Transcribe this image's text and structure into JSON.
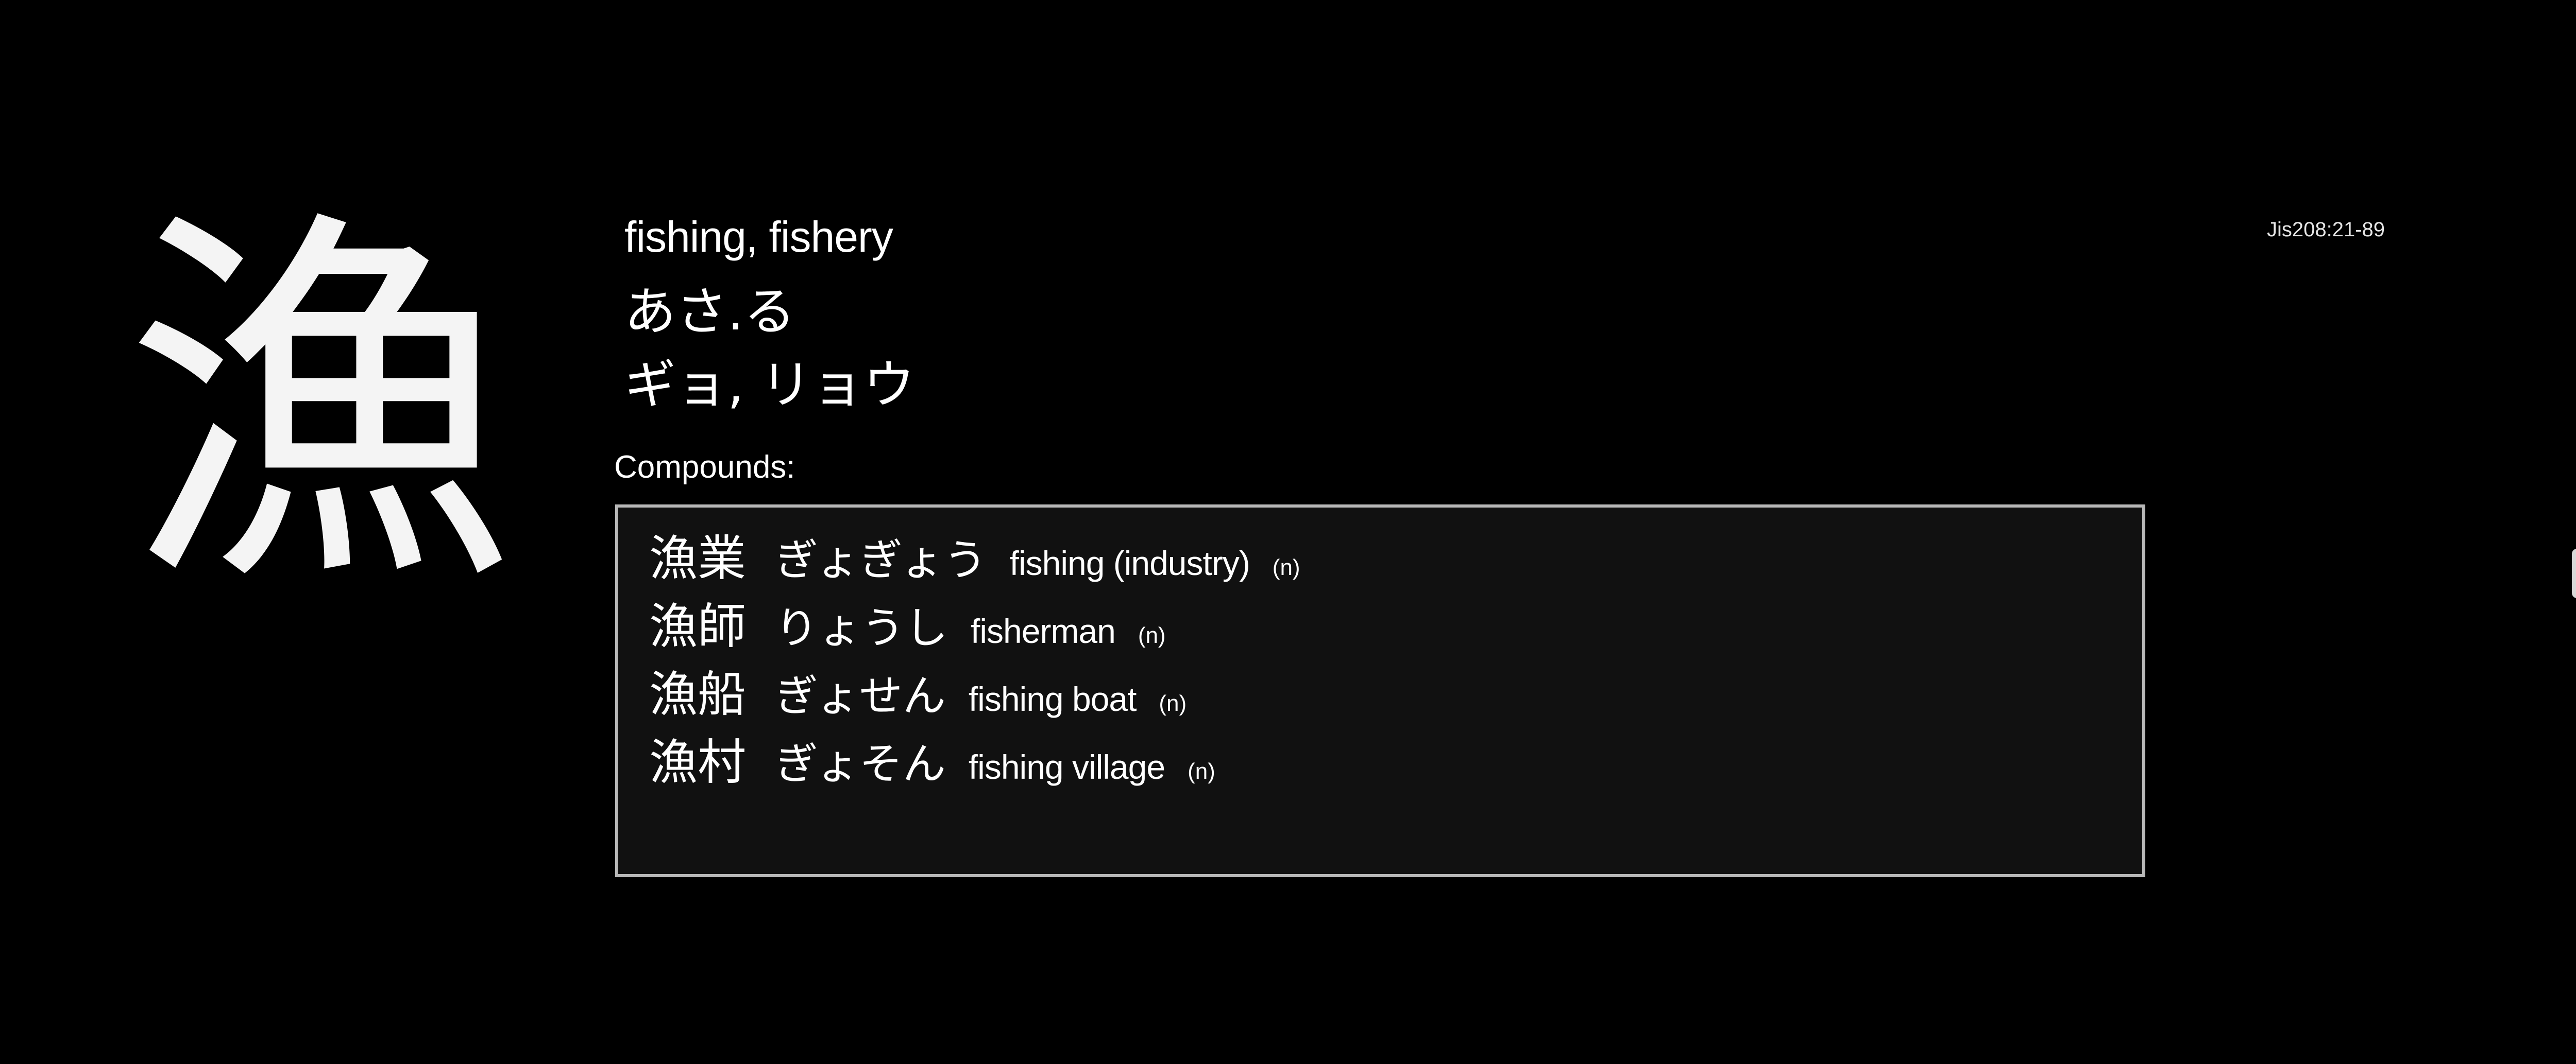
{
  "kanji": {
    "character": "漁",
    "meaning": "fishing, fishery",
    "kun_reading": "あさ.る",
    "on_reading": "ギョ, リョウ",
    "jis_code": "Jis208:21-89"
  },
  "compounds": {
    "label": "Compounds:",
    "items": [
      {
        "word": "漁業",
        "reading": "ぎょぎょう",
        "gloss": "fishing (industry)",
        "pos": "(n)"
      },
      {
        "word": "漁師",
        "reading": "りょうし",
        "gloss": "fisherman",
        "pos": "(n)"
      },
      {
        "word": "漁船",
        "reading": "ぎょせん",
        "gloss": "fishing boat",
        "pos": "(n)"
      },
      {
        "word": "漁村",
        "reading": "ぎょそん",
        "gloss": "fishing village",
        "pos": "(n)"
      }
    ]
  },
  "colors": {
    "background": "#000000",
    "text": "#ffffff",
    "box_border": "#b8b8b8",
    "box_background": "#111111"
  },
  "icons": {
    "scroll_tab": "scroll-handle-icon"
  }
}
